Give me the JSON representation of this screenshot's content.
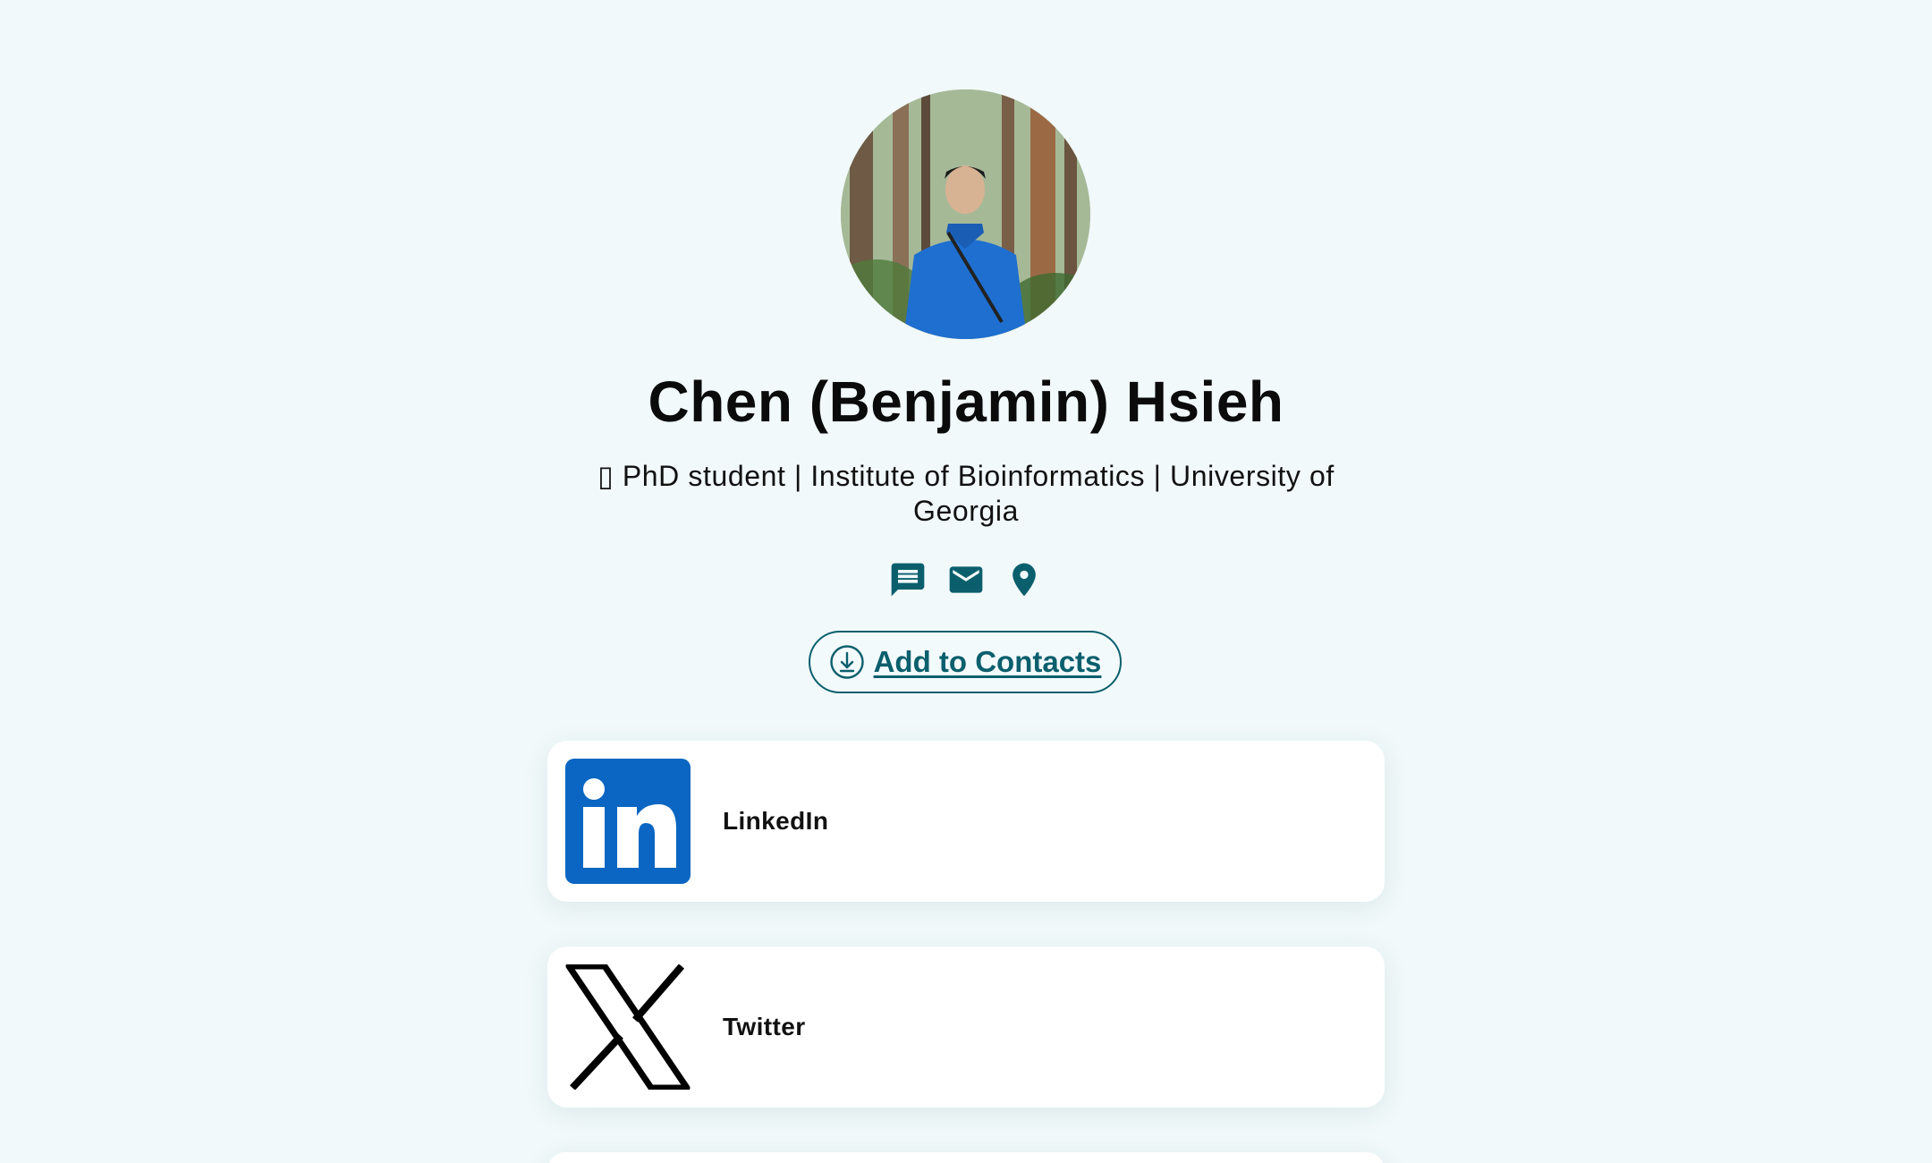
{
  "profile": {
    "name": "Chen (Benjamin) Hsieh",
    "bio": "▯ PhD student | Institute of Bioinformatics | University of Georgia"
  },
  "contact_icons": [
    {
      "icon": "message-icon"
    },
    {
      "icon": "email-icon"
    },
    {
      "icon": "location-pin-icon"
    }
  ],
  "add_contact": {
    "label": "Add to Contacts",
    "icon": "download-circle-icon"
  },
  "links": [
    {
      "label": "LinkedIn",
      "icon": "linkedin-icon"
    },
    {
      "label": "Twitter",
      "icon": "x-twitter-icon"
    }
  ],
  "colors": {
    "background": "#f1f9fa",
    "accent": "#0b5f6d",
    "linkedin": "#0a66c2",
    "card": "#ffffff"
  }
}
